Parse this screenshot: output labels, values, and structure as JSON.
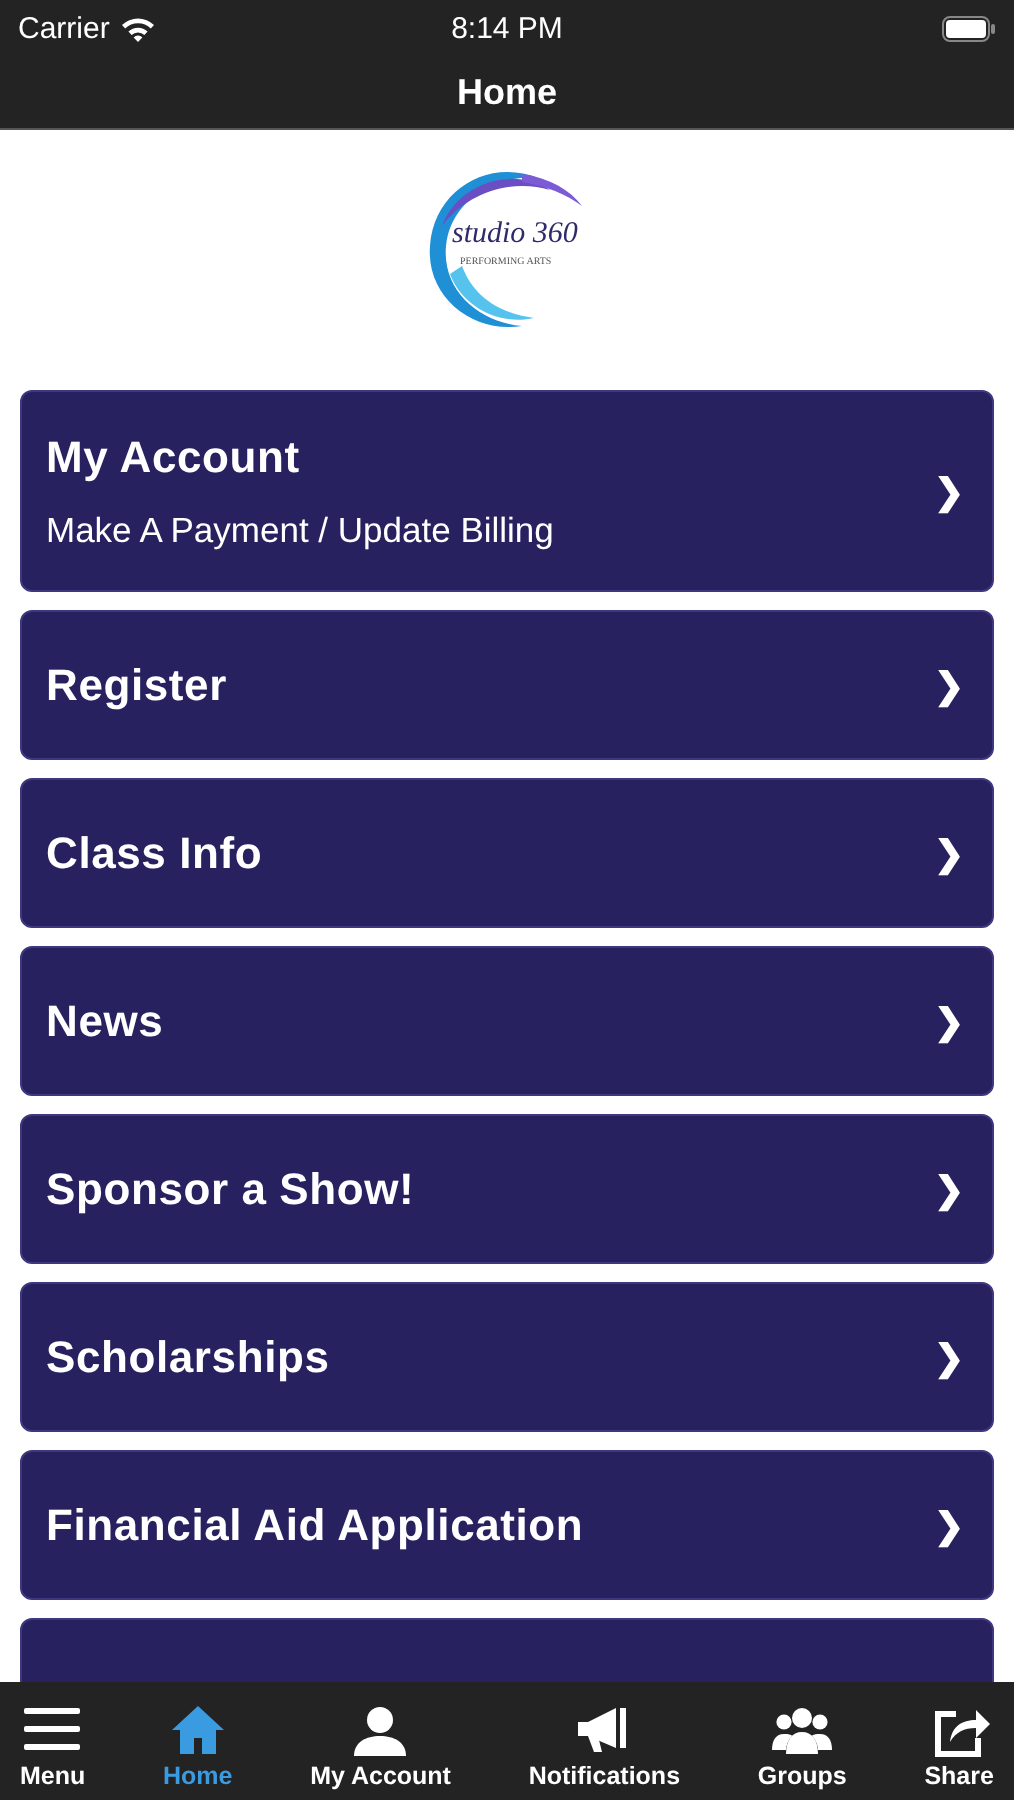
{
  "status_bar": {
    "carrier": "Carrier",
    "time": "8:14 PM"
  },
  "nav_bar": {
    "title": "Home"
  },
  "logo": {
    "name": "studio 360",
    "tagline": "PERFORMING ARTS"
  },
  "menu_items": [
    {
      "title": "My Account",
      "subtitle": "Make A Payment / Update Billing",
      "chevron": "❯"
    },
    {
      "title": "Register",
      "chevron": "❯"
    },
    {
      "title": "Class Info",
      "chevron": "❯"
    },
    {
      "title": "News",
      "chevron": "❯"
    },
    {
      "title": "Sponsor a Show!",
      "chevron": "❯"
    },
    {
      "title": "Scholarships",
      "chevron": "❯"
    },
    {
      "title": "Financial Aid Application",
      "chevron": "❯"
    },
    {
      "kind": "partial"
    }
  ],
  "tab_bar": [
    {
      "label": "Menu",
      "selected": false
    },
    {
      "label": "Home",
      "selected": true
    },
    {
      "label": "My Account",
      "selected": false
    },
    {
      "label": "Notifications",
      "selected": false
    },
    {
      "label": "Groups",
      "selected": false
    },
    {
      "label": "Share",
      "selected": false
    }
  ]
}
